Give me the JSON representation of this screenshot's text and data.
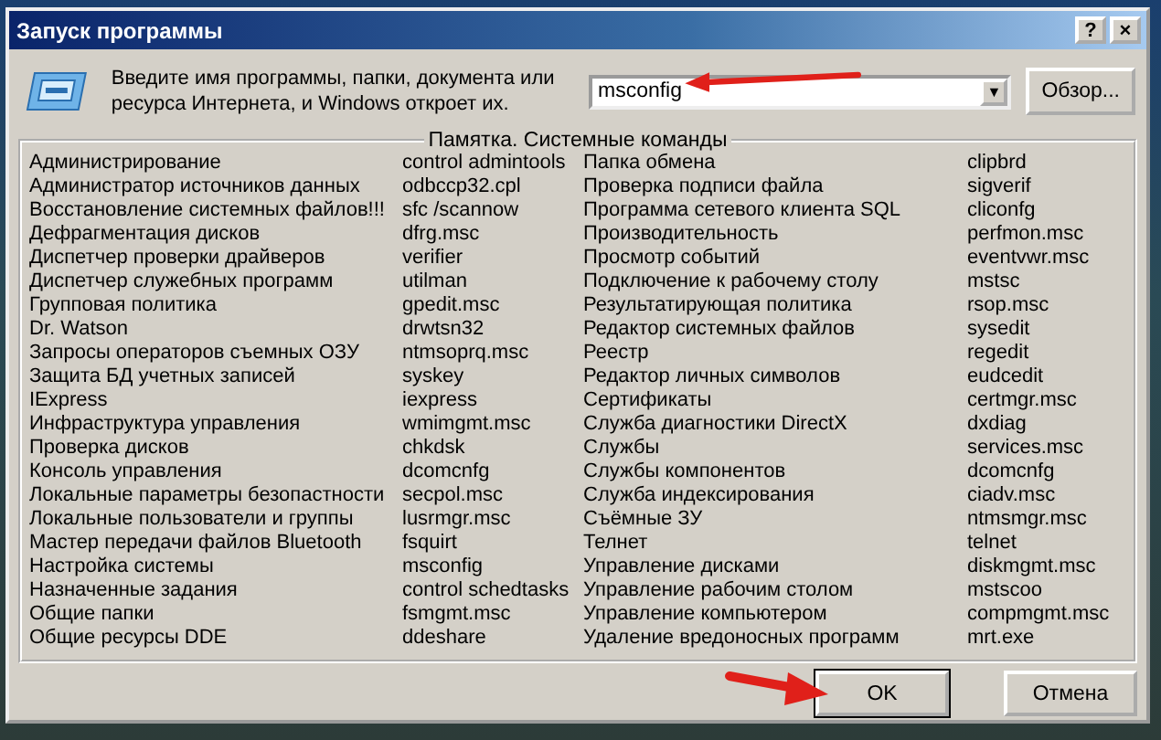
{
  "window": {
    "title": "Запуск программы",
    "help_button": "?",
    "close_button": "×"
  },
  "prompt": {
    "text": "Введите имя программы, папки, документа или ресурса Интернета, и Windows откроет их."
  },
  "command_field": {
    "value": "msconfig",
    "dropdown": "▼"
  },
  "browse_button": "Обзор...",
  "group": {
    "title": "Памятка. Системные команды",
    "left": [
      {
        "name": "Администрирование",
        "command": "control admintools"
      },
      {
        "name": "Администратор источников данных",
        "command": "odbccp32.cpl"
      },
      {
        "name": "Восстановление системных файлов!!!",
        "command": "sfc /scannow"
      },
      {
        "name": "Дефрагментация дисков",
        "command": "dfrg.msc"
      },
      {
        "name": "Диспетчер проверки драйверов",
        "command": "verifier"
      },
      {
        "name": "Диспетчер служебных программ",
        "command": "utilman"
      },
      {
        "name": "Групповая политика",
        "command": "gpedit.msc"
      },
      {
        "name": "Dr. Watson",
        "command": "drwtsn32"
      },
      {
        "name": "Запросы операторов съемных ОЗУ",
        "command": "ntmsoprq.msc"
      },
      {
        "name": "Защита БД учетных записей",
        "command": "syskey"
      },
      {
        "name": "IExpress",
        "command": "iexpress"
      },
      {
        "name": "Инфраструктура управления",
        "command": "wmimgmt.msc"
      },
      {
        "name": "Проверка дисков",
        "command": "chkdsk"
      },
      {
        "name": "Консоль управления",
        "command": "dcomcnfg"
      },
      {
        "name": "Локальные параметры безопастности",
        "command": "secpol.msc"
      },
      {
        "name": "Локальные пользователи и группы",
        "command": "lusrmgr.msc"
      },
      {
        "name": "Мастер передачи файлов Bluetooth",
        "command": "fsquirt"
      },
      {
        "name": "Настройка системы",
        "command": "msconfig"
      },
      {
        "name": "Назначенные задания",
        "command": "control schedtasks"
      },
      {
        "name": "Общие папки",
        "command": "fsmgmt.msc"
      },
      {
        "name": "Общие ресурсы DDE",
        "command": "ddeshare"
      }
    ],
    "right": [
      {
        "name": "Папка обмена",
        "command": "clipbrd"
      },
      {
        "name": "Проверка подписи файла",
        "command": "sigverif"
      },
      {
        "name": "Программа сетевого клиента SQL",
        "command": "cliconfg"
      },
      {
        "name": "Производительность",
        "command": "perfmon.msc"
      },
      {
        "name": "Просмотр событий",
        "command": "eventvwr.msc"
      },
      {
        "name": "Подключение к рабочему столу",
        "command": "mstsc"
      },
      {
        "name": "Результатирующая политика",
        "command": "rsop.msc"
      },
      {
        "name": "Редактор системных файлов",
        "command": "sysedit"
      },
      {
        "name": "Реестр",
        "command": "regedit"
      },
      {
        "name": "Редактор личных символов",
        "command": "eudcedit"
      },
      {
        "name": "Сертификаты",
        "command": "certmgr.msc"
      },
      {
        "name": "Служба диагностики DirectX",
        "command": "dxdiag"
      },
      {
        "name": "Службы",
        "command": "services.msc"
      },
      {
        "name": "Службы компонентов",
        "command": "dcomcnfg"
      },
      {
        "name": "Служба индексирования",
        "command": "ciadv.msc"
      },
      {
        "name": "Съёмные ЗУ",
        "command": "ntmsmgr.msc"
      },
      {
        "name": "Телнет",
        "command": "telnet"
      },
      {
        "name": "Управление дисками",
        "command": "diskmgmt.msc"
      },
      {
        "name": "Управление рабочим столом",
        "command": "mstscoo"
      },
      {
        "name": "Управление компьютером",
        "command": "compmgmt.msc"
      },
      {
        "name": "Удаление вредоносных программ",
        "command": "mrt.exe"
      }
    ]
  },
  "buttons": [
    {
      "label": "OK",
      "default": true
    },
    {
      "label": "Отмена",
      "default": false
    }
  ]
}
